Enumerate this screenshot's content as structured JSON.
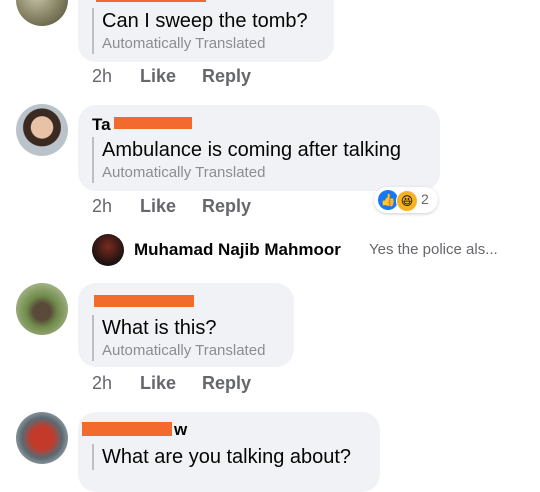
{
  "comments": [
    {
      "text": "Can I sweep the tomb?",
      "translated_label": "Automatically Translated",
      "time": "2h",
      "like_label": "Like",
      "reply_label": "Reply"
    },
    {
      "name_prefix": "Ta",
      "text": "Ambulance is coming after talking",
      "translated_label": "Automatically Translated",
      "time": "2h",
      "like_label": "Like",
      "reply_label": "Reply",
      "reaction_count": "2"
    },
    {
      "text": "What is this?",
      "translated_label": "Automatically Translated",
      "time": "2h",
      "like_label": "Like",
      "reply_label": "Reply"
    },
    {
      "name_suffix": "w",
      "text": "What are you talking about?"
    }
  ],
  "reply_preview": {
    "author": "Muhamad Najib Mahmoor",
    "snippet": "Yes the police als..."
  },
  "colors": {
    "bubble": "#f0f2f5",
    "redaction": "#f26b2c",
    "secondary_text": "#65676b",
    "translated_text": "#8a8d91",
    "like_blue": "#1877f2",
    "haha_yellow": "#f7b125"
  }
}
